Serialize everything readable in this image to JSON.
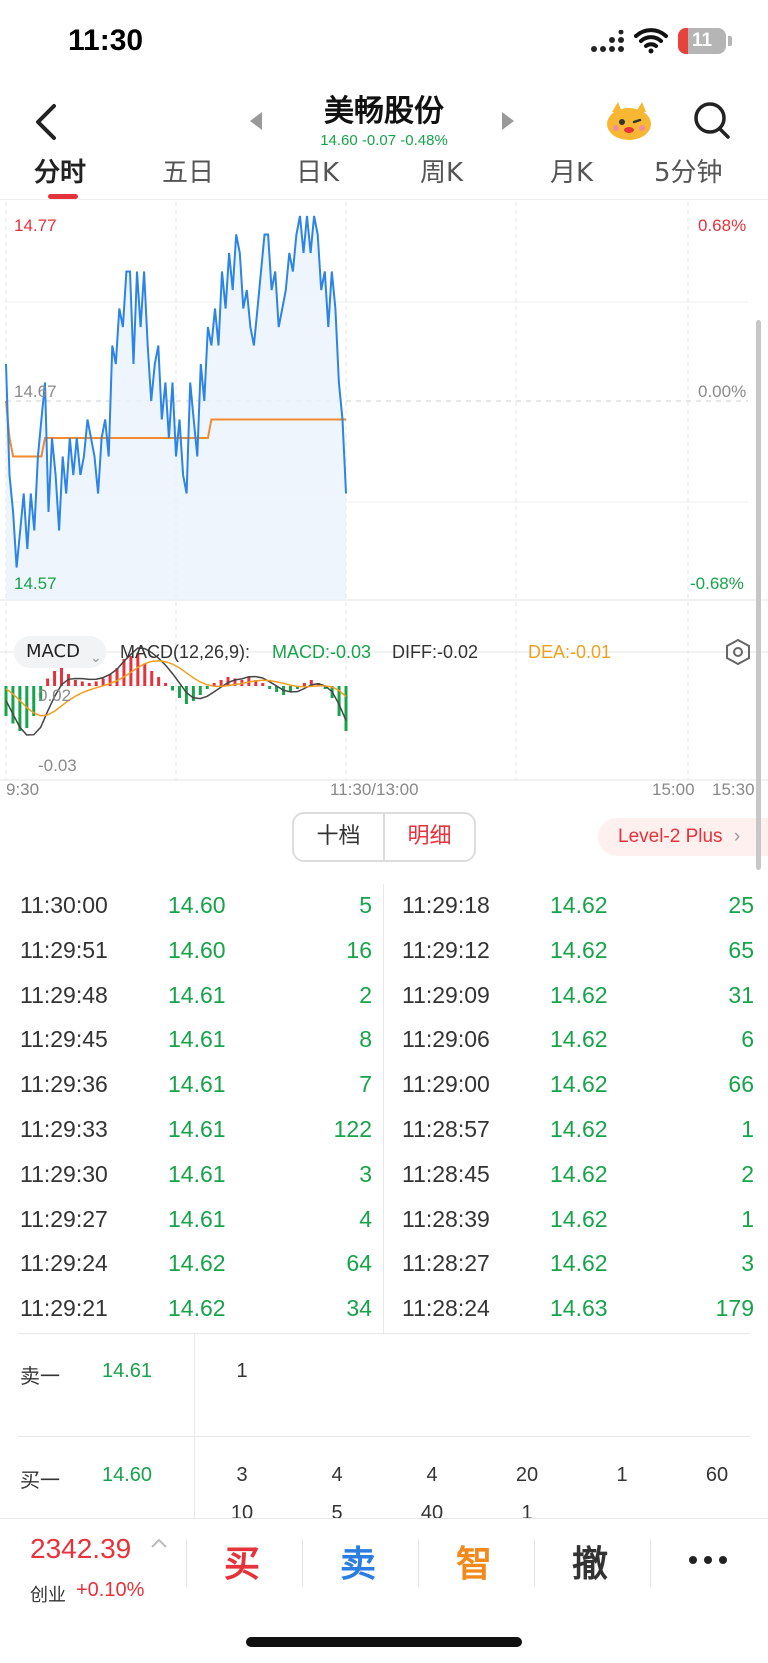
{
  "status": {
    "time": "11:30",
    "battery": "11"
  },
  "header": {
    "stock_name": "美畅股份",
    "quote": "14.60 -0.07 -0.48%"
  },
  "tabs": [
    "分时",
    "五日",
    "日K",
    "周K",
    "月K",
    "5分钟"
  ],
  "chart": {
    "price_high": "14.77",
    "price_mid": "14.67",
    "price_low": "14.57",
    "pct_high": "0.68%",
    "pct_mid": "0.00%",
    "pct_low": "-0.68%",
    "macd_high": "0.02",
    "macd_low": "-0.03",
    "colors": {
      "price_line": "#2b84e6",
      "avg_line": "#f28a2e",
      "up": "#e5323b",
      "down": "#17a34a"
    }
  },
  "chart_data": {
    "type": "line",
    "x_range": [
      "9:30",
      "15:30"
    ],
    "ylim": [
      14.57,
      14.77
    ],
    "series": [
      {
        "values": [
          14.69,
          14.63,
          14.61,
          14.58,
          14.6,
          14.62,
          14.59,
          14.62,
          14.6,
          14.64,
          14.66,
          14.68,
          14.61,
          14.65,
          14.63,
          14.6,
          14.64,
          14.62,
          14.65,
          14.63,
          14.65,
          14.63,
          14.64,
          14.66,
          14.65,
          14.64,
          14.62,
          14.65,
          14.66,
          14.64,
          14.7,
          14.69,
          14.72,
          14.71,
          14.74,
          14.74,
          14.69,
          14.74,
          14.71,
          14.74,
          14.7,
          14.67,
          14.69,
          14.7,
          14.66,
          14.68,
          14.65,
          14.68,
          14.64,
          14.66,
          14.63,
          14.62,
          14.68,
          14.66,
          14.64,
          14.69,
          14.67,
          14.71,
          14.7,
          14.72,
          14.7,
          14.74,
          14.72,
          14.75,
          14.73,
          14.76,
          14.75,
          14.72,
          14.73,
          14.71,
          14.7,
          14.72,
          14.74,
          14.76,
          14.76,
          14.73,
          14.74,
          14.71,
          14.72,
          14.73,
          14.75,
          14.74,
          14.76,
          14.77,
          14.75,
          14.77,
          14.75,
          14.77,
          14.76,
          14.73,
          14.74,
          14.71,
          14.74,
          14.72,
          14.68,
          14.66,
          14.62
        ]
      },
      {
        "values": [
          14.67,
          14.65,
          14.64,
          14.64,
          14.64,
          14.64,
          14.64,
          14.64,
          14.64,
          14.64,
          14.64,
          14.65,
          14.65,
          14.65,
          14.65,
          14.65,
          14.65,
          14.65,
          14.65,
          14.65,
          14.65,
          14.65,
          14.65,
          14.65,
          14.65,
          14.65,
          14.65,
          14.65,
          14.65,
          14.65,
          14.65,
          14.65,
          14.65,
          14.65,
          14.65,
          14.65,
          14.65,
          14.65,
          14.65,
          14.65,
          14.65,
          14.65,
          14.65,
          14.65,
          14.65,
          14.65,
          14.65,
          14.65,
          14.65,
          14.65,
          14.65,
          14.65,
          14.65,
          14.65,
          14.65,
          14.65,
          14.65,
          14.65,
          14.66,
          14.66,
          14.66,
          14.66,
          14.66,
          14.66,
          14.66,
          14.66,
          14.66,
          14.66,
          14.66,
          14.66,
          14.66,
          14.66,
          14.66,
          14.66,
          14.66,
          14.66,
          14.66,
          14.66,
          14.66,
          14.66,
          14.66,
          14.66,
          14.66,
          14.66,
          14.66,
          14.66,
          14.66,
          14.66,
          14.66,
          14.66,
          14.66,
          14.66,
          14.66,
          14.66,
          14.66,
          14.66,
          14.66
        ]
      }
    ],
    "macd_bars": [
      -0.02,
      -0.025,
      -0.03,
      -0.028,
      -0.02,
      -0.01,
      0.005,
      0.01,
      0.012,
      0.008,
      0.004,
      0.003,
      0.002,
      0.003,
      0.005,
      0.008,
      0.012,
      0.018,
      0.02,
      0.022,
      0.015,
      0.01,
      0.006,
      0.002,
      -0.003,
      -0.008,
      -0.012,
      -0.01,
      -0.006,
      -0.002,
      0.002,
      0.004,
      0.006,
      0.005,
      0.004,
      0.006,
      0.004,
      0.002,
      -0.002,
      -0.004,
      -0.006,
      -0.004,
      -0.002,
      0.002,
      0.004,
      0.002,
      -0.002,
      -0.008,
      -0.02,
      -0.03
    ]
  },
  "macd": {
    "selector": "MACD",
    "params": "MACD(12,26,9):",
    "macd": "MACD:-0.03",
    "diff": "DIFF:-0.02",
    "dea": "DEA:-0.01"
  },
  "time_axis": {
    "start": "9:30",
    "mid": "11:30/13:00",
    "close": "15:00",
    "end": "15:30"
  },
  "toggle": {
    "left": "十档",
    "right": "明细"
  },
  "level2": "Level-2 Plus",
  "trades_left": [
    [
      "11:30:00",
      "14.60",
      "5"
    ],
    [
      "11:29:51",
      "14.60",
      "16"
    ],
    [
      "11:29:48",
      "14.61",
      "2"
    ],
    [
      "11:29:45",
      "14.61",
      "8"
    ],
    [
      "11:29:36",
      "14.61",
      "7"
    ],
    [
      "11:29:33",
      "14.61",
      "122"
    ],
    [
      "11:29:30",
      "14.61",
      "3"
    ],
    [
      "11:29:27",
      "14.61",
      "4"
    ],
    [
      "11:29:24",
      "14.62",
      "64"
    ],
    [
      "11:29:21",
      "14.62",
      "34"
    ]
  ],
  "trades_right": [
    [
      "11:29:18",
      "14.62",
      "25"
    ],
    [
      "11:29:12",
      "14.62",
      "65"
    ],
    [
      "11:29:09",
      "14.62",
      "31"
    ],
    [
      "11:29:06",
      "14.62",
      "6"
    ],
    [
      "11:29:00",
      "14.62",
      "66"
    ],
    [
      "11:28:57",
      "14.62",
      "1"
    ],
    [
      "11:28:45",
      "14.62",
      "2"
    ],
    [
      "11:28:39",
      "14.62",
      "1"
    ],
    [
      "11:28:27",
      "14.62",
      "3"
    ],
    [
      "11:28:24",
      "14.63",
      "179"
    ]
  ],
  "order_book": {
    "sell_label": "卖一",
    "sell_price": "14.61",
    "sell_qty": [
      "1"
    ],
    "buy_label": "买一",
    "buy_price": "14.60",
    "buy_qty": [
      "3",
      "4",
      "4",
      "20",
      "1",
      "60"
    ],
    "buy_qty_row2": [
      "10",
      "5",
      "40",
      "1"
    ]
  },
  "bottom": {
    "index_value": "2342.39",
    "index_name": "创业",
    "index_change": "+0.10%",
    "buy": "买",
    "sell": "卖",
    "smart": "智",
    "cancel": "撤"
  }
}
